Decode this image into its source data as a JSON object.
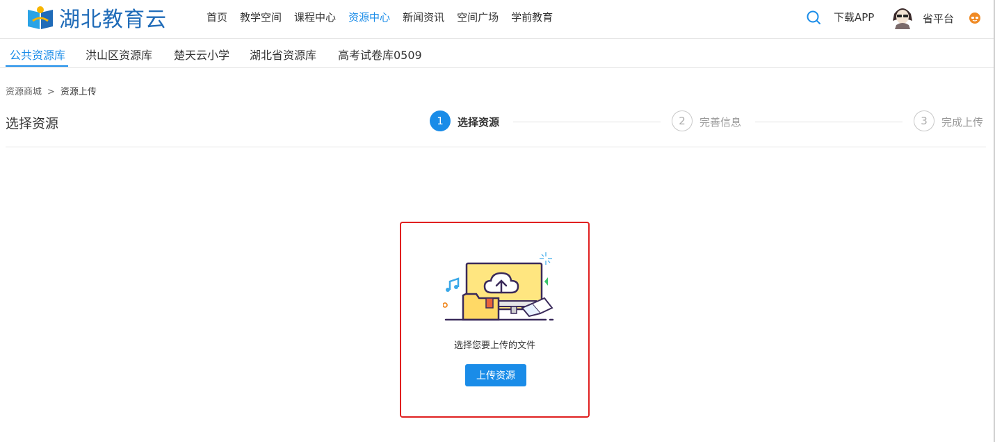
{
  "header": {
    "logo_text": "湖北教育云",
    "nav": [
      {
        "label": "首页",
        "active": false
      },
      {
        "label": "教学空间",
        "active": false
      },
      {
        "label": "课程中心",
        "active": false
      },
      {
        "label": "资源中心",
        "active": true
      },
      {
        "label": "新闻资讯",
        "active": false
      },
      {
        "label": "空间广场",
        "active": false
      },
      {
        "label": "学前教育",
        "active": false
      }
    ],
    "download_label": "下载APP",
    "platform_label": "省平台"
  },
  "tabs": [
    {
      "label": "公共资源库",
      "active": true
    },
    {
      "label": "洪山区资源库",
      "active": false
    },
    {
      "label": "楚天云小学",
      "active": false
    },
    {
      "label": "湖北省资源库",
      "active": false
    },
    {
      "label": "高考试卷库0509",
      "active": false
    }
  ],
  "breadcrumb": {
    "parent": "资源商城",
    "separator": ">",
    "current": "资源上传"
  },
  "section_title": "选择资源",
  "steps": [
    {
      "number": "1",
      "label": "选择资源",
      "active": true
    },
    {
      "number": "2",
      "label": "完善信息",
      "active": false
    },
    {
      "number": "3",
      "label": "完成上传",
      "active": false
    }
  ],
  "upload": {
    "hint": "选择您要上传的文件",
    "button_label": "上传资源",
    "illustration_icon": "cloud-upload-monitor-icon"
  },
  "colors": {
    "accent": "#1a8ce8",
    "highlight_border": "#e02020"
  }
}
